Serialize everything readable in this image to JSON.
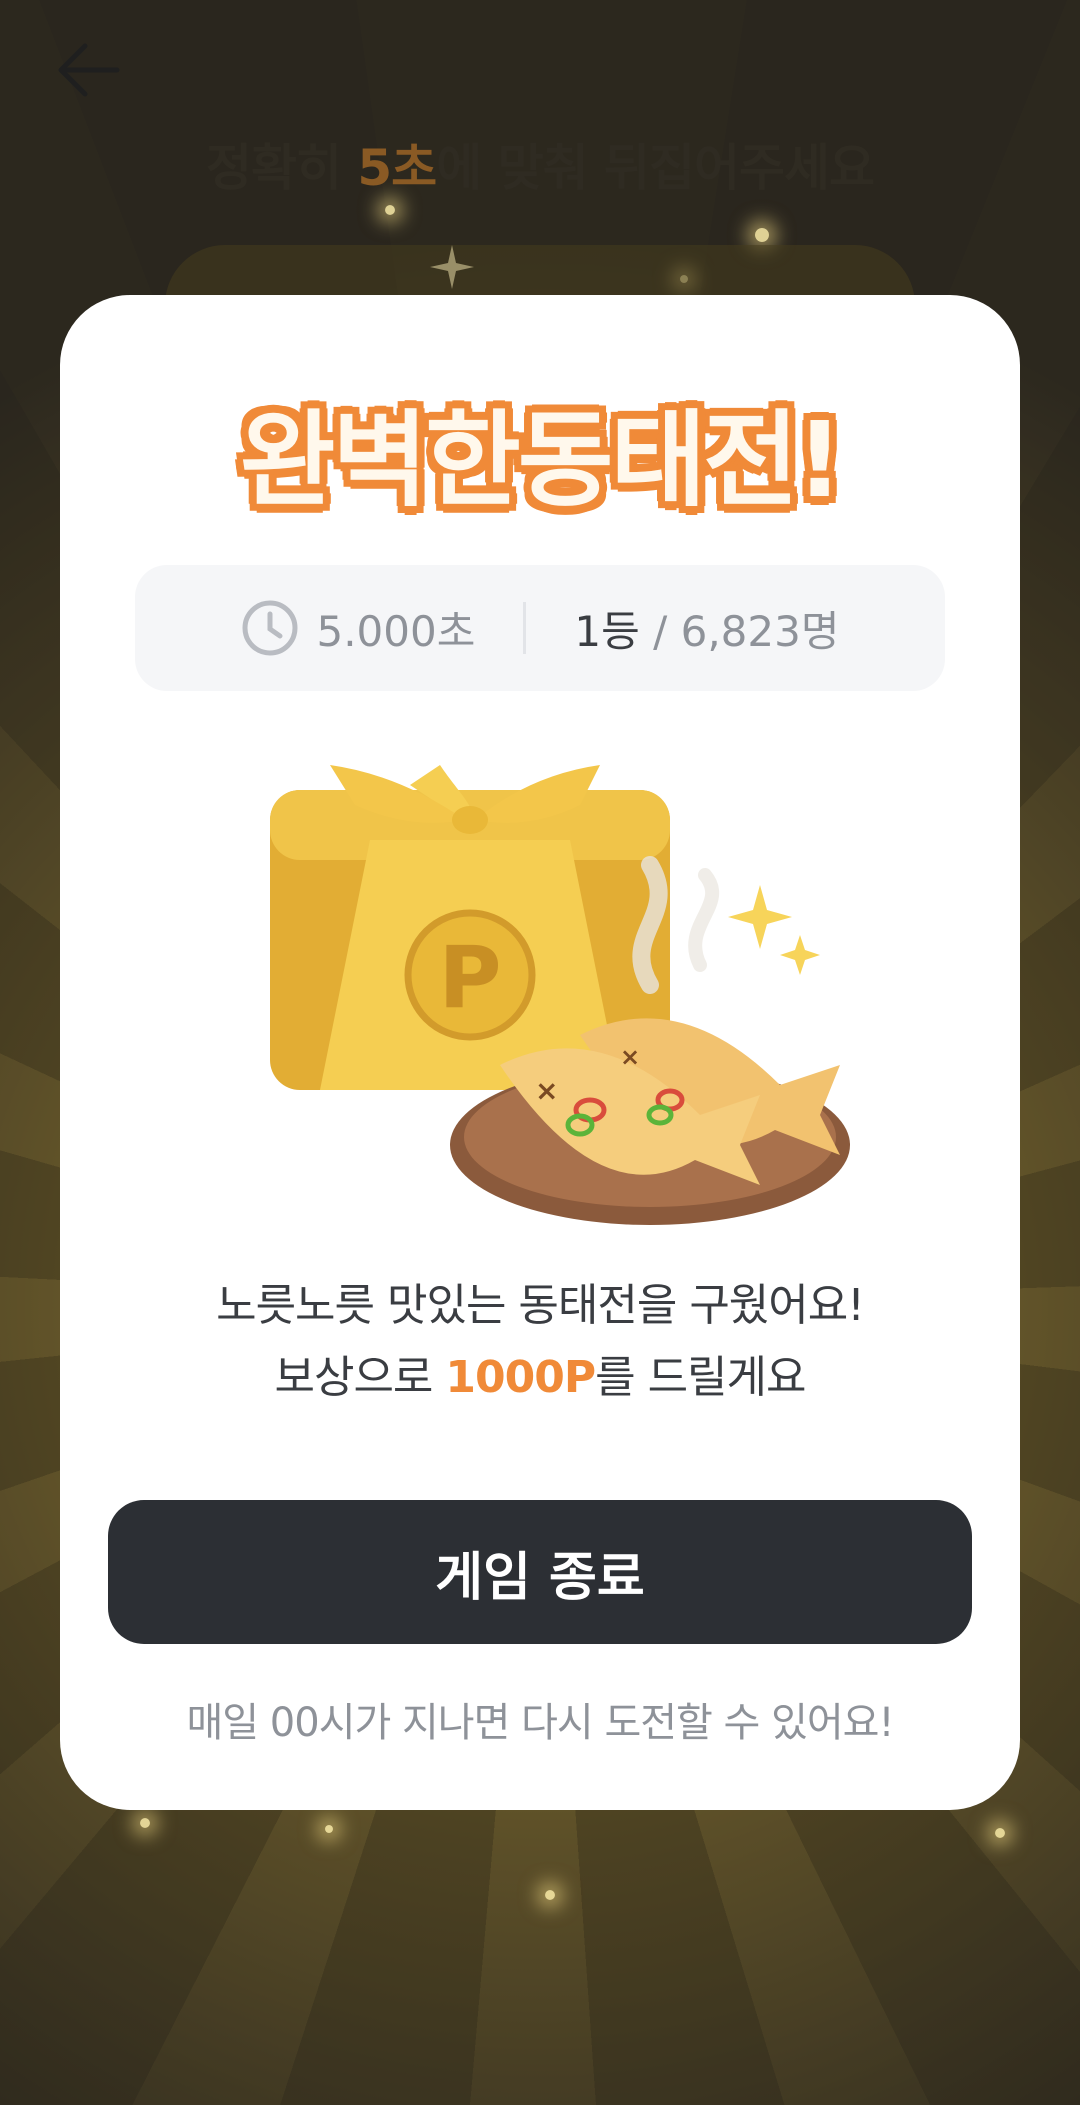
{
  "header": {
    "instruction_prefix": "정확히 ",
    "instruction_highlight": "5초",
    "instruction_suffix": "에 맞춰 뒤집어주세요"
  },
  "modal": {
    "title": "완벽한동태전!",
    "stats": {
      "time": "5.000초",
      "rank": "1등",
      "separator": " / ",
      "participants": "6,823명"
    },
    "message_line1": "노릇노릇 맛있는 동태전을 구웠어요!",
    "message_line2_prefix": "보상으로 ",
    "reward_points": "1000P",
    "message_line2_suffix": "를 드릴게요",
    "end_button_label": "게임 종료",
    "footer_note": "매일 00시가 지나면 다시 도전할 수 있어요!"
  },
  "icons": {
    "back": "arrow-left-icon",
    "clock": "clock-icon",
    "gift": "gift-box-p-icon",
    "fish": "fish-pancake-plate-icon"
  },
  "colors": {
    "accent": "#f08a38",
    "button_dark": "#2c2f34",
    "text_gray": "#8e9299",
    "gift_gold": "#e9b838"
  }
}
